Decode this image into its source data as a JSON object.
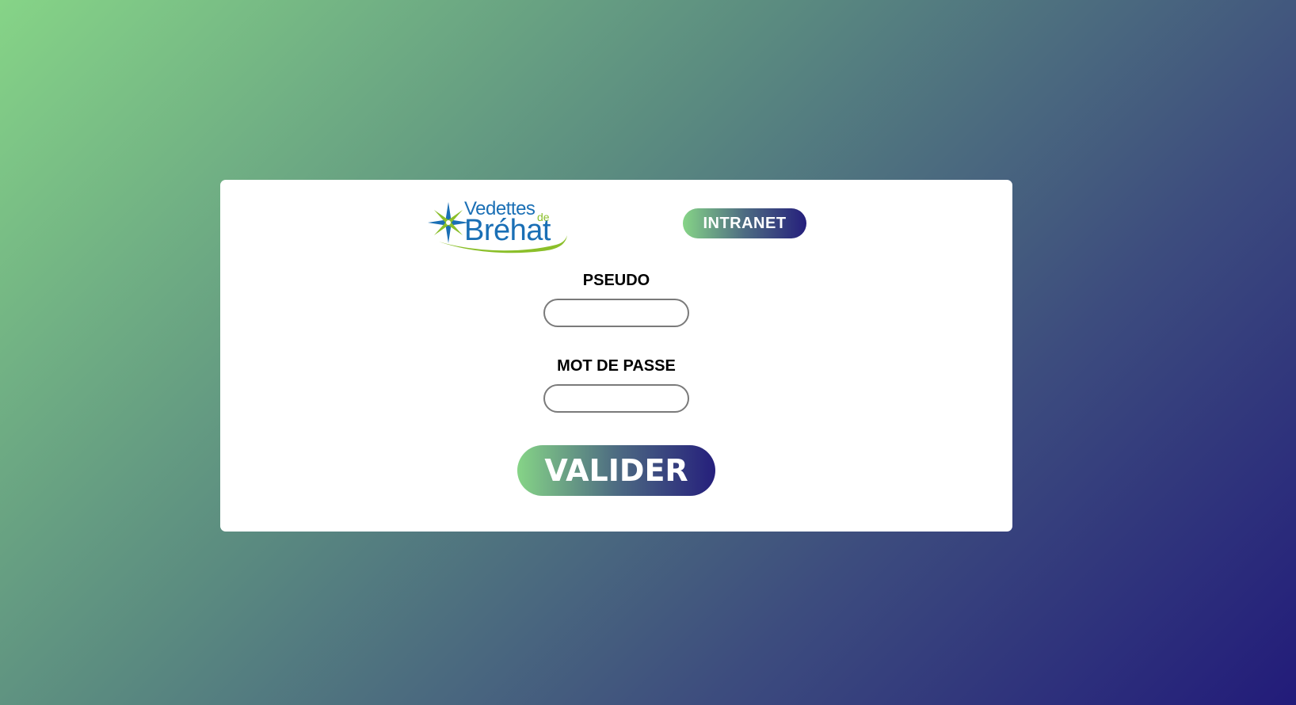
{
  "brand": {
    "line1": "Vedettes",
    "line2": "de",
    "line3": "Bréhat",
    "colors": {
      "blue": "#1a6fb5",
      "green": "#8bbf2a"
    }
  },
  "badge": {
    "label": "INTRANET"
  },
  "form": {
    "pseudo_label": "PSEUDO",
    "pseudo_value": "",
    "password_label": "MOT DE PASSE",
    "password_value": "",
    "submit_label": "VALIDER"
  },
  "colors": {
    "gradient_start": "#86d487",
    "gradient_end": "#221b7a",
    "card_background": "#ffffff"
  }
}
